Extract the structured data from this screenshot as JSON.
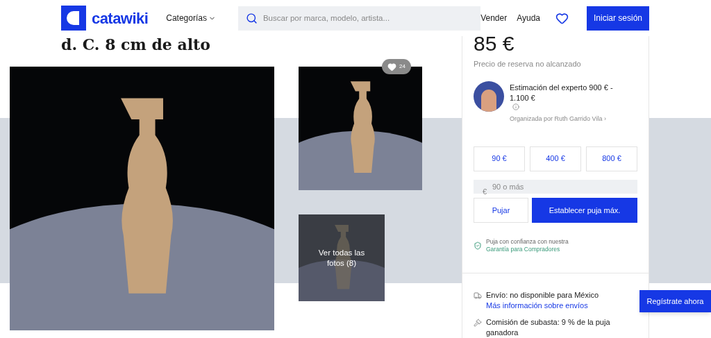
{
  "header": {
    "logo": "catawiki",
    "categories": "Categorías",
    "search": {
      "placeholder": "Buscar por marca, modelo, artista..."
    },
    "links": [
      "Vender",
      "Ayuda"
    ],
    "login": "Iniciar sesión"
  },
  "lot": {
    "title": "d. C. 8 cm de alto",
    "favorites": "24",
    "all_photos": "Ver todas las fotos (8)"
  },
  "bid_panel": {
    "price": "85 €",
    "reserve": "Precio de reserva no alcanzado",
    "estimate": "Estimación del experto 900 € - 1.100 €",
    "curator": "Organizada por Ruth Garrido Vila ›",
    "quick_bids": [
      "90 €",
      "400 €",
      "800 €"
    ],
    "bid_input": {
      "currency": "€",
      "placeholder": "90 o más"
    },
    "bid_button": "Pujar",
    "max_bid_button": "Establecer puja máx.",
    "guarantee": {
      "text": "Puja con confianza con nuestra",
      "link": "Garantía para Compradores"
    },
    "shipping": {
      "text": "Envío: no disponible para México",
      "link": "Más información sobre envíos"
    },
    "commission": "Comisión de subasta: 9 % de la puja ganadora"
  },
  "register_button": "Regístrate ahora"
}
